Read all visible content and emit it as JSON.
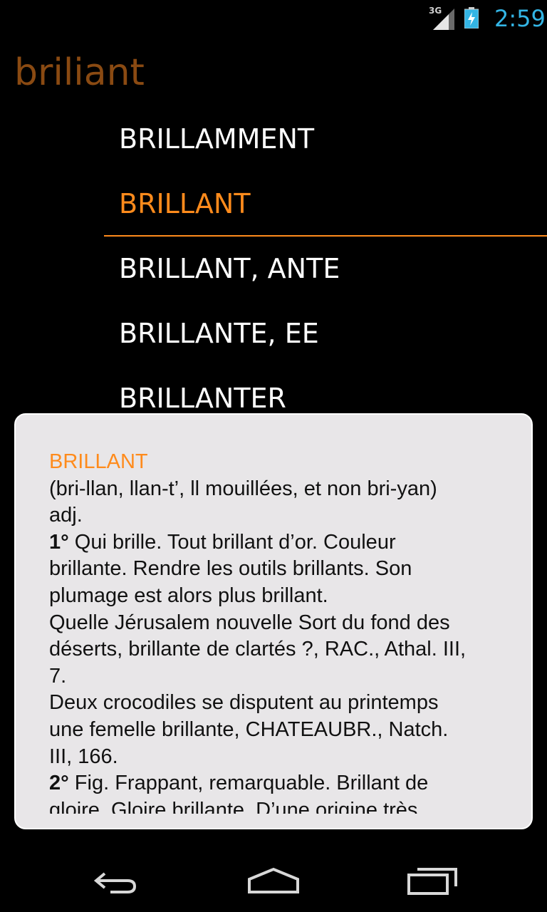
{
  "status_bar": {
    "network_type": "3G",
    "time": "2:59",
    "icons": [
      "signal-icon",
      "battery-charging-icon"
    ]
  },
  "search": {
    "term": "briliant"
  },
  "word_list": {
    "items": [
      {
        "label": "BRILLAMMENT",
        "selected": false
      },
      {
        "label": "BRILLANT",
        "selected": true
      },
      {
        "label": "BRILLANT, ANTE",
        "selected": false
      },
      {
        "label": "BRILLANTE, EE",
        "selected": false
      },
      {
        "label": "BRILLANTER",
        "selected": false
      }
    ]
  },
  "definition": {
    "headword": "BRILLANT",
    "pronunciation": "(bri-llan, llan-t’, ll mouillées, et non bri-yan)",
    "pos": "adj.",
    "sense1_number": "1°",
    "sense1_line1": "Qui brille. Tout brillant d’or. Couleur",
    "sense1_line2": "brillante. Rendre les outils brillants. Son",
    "sense1_line3": "plumage est alors plus brillant.",
    "quote1_line1": "Quelle Jérusalem nouvelle Sort du fond des",
    "quote1_line2": "déserts, brillante de clartés ?, RAC., Athal. III,",
    "quote1_line3": "7.",
    "quote2_line1": "Deux crocodiles se disputent au printemps",
    "quote2_line2": "une femelle brillante, CHATEAUBR., Natch.",
    "quote2_line3": "III, 166.",
    "sense2_number": "2°",
    "sense2_line1": "Fig. Frappant, remarquable. Brillant de",
    "sense2_line2": "gloire. Gloire brillante. D’une origine très"
  },
  "nav_bar": {
    "buttons": [
      "back-icon",
      "home-icon",
      "recent-apps-icon"
    ]
  },
  "colors": {
    "accent": "#ff8b1c",
    "search_term": "#8a4a12",
    "clock": "#33b5e5",
    "panel_bg": "#e8e6e8"
  }
}
